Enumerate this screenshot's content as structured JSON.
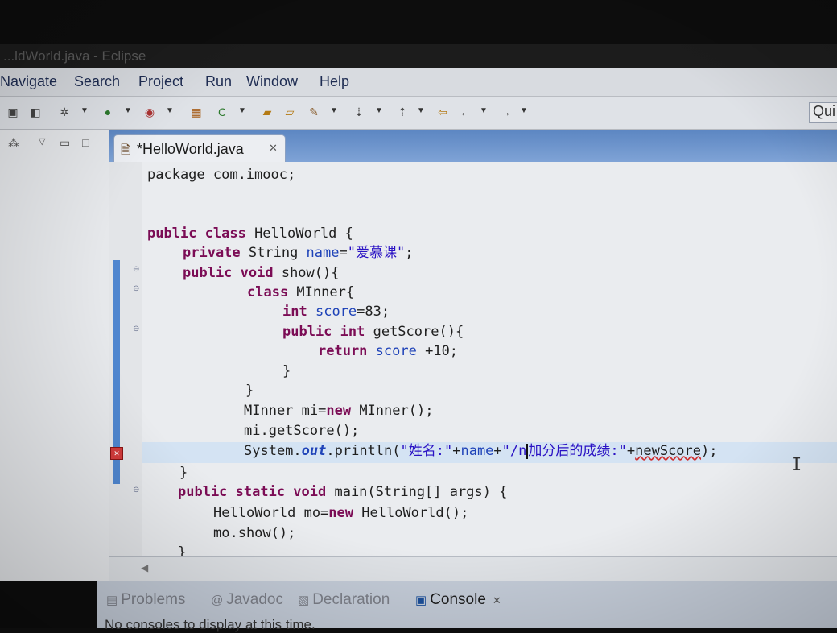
{
  "window": {
    "title": "...ldWorld.java - Eclipse"
  },
  "menu": [
    "Navigate",
    "Search",
    "Project",
    "Run",
    "Window",
    "Help"
  ],
  "toolbar": {
    "quick_access": "Qui",
    "icons": [
      "save-icon",
      "print-icon",
      "debug-icon",
      "run-icon",
      "external-tools-icon",
      "new-java-package-icon",
      "new-class-icon",
      "open-type-icon",
      "open-task-icon",
      "search-icon",
      "next-annotation-icon",
      "prev-annotation-icon",
      "last-edit-icon",
      "back-icon",
      "forward-icon"
    ]
  },
  "editor": {
    "tab_title": "*HelloWorld.java",
    "lines": {
      "l1": "package com.imooc;",
      "l3a": "public class",
      "l3b": " HelloWorld {",
      "l4a": "private",
      "l4b": " String ",
      "l4c": "name",
      "l4d": "=",
      "l4e": "\"爱慕课\"",
      "l4f": ";",
      "l5a": "public void",
      "l5b": " show(){",
      "l6a": "class",
      "l6b": " MInner{",
      "l7a": "int",
      "l7b": " ",
      "l7c": "score",
      "l7d": "=83;",
      "l8a": "public int",
      "l8b": " getScore(){",
      "l9a": "return",
      "l9b": " ",
      "l9c": "score",
      "l9d": " +10;",
      "l10": "}",
      "l11": "}",
      "l12a": "MInner mi=",
      "l12b": "new",
      "l12c": " MInner();",
      "l13": "mi.getScore();",
      "l14a": "System.",
      "l14b": "out",
      "l14c": ".println(",
      "l14d": "\"姓名:\"",
      "l14e": "+",
      "l14f": "name",
      "l14g": "+",
      "l14h": "\"/n",
      "l14i": "加分后的成绩:\"",
      "l14j": "+",
      "l14k": "newScore",
      "l14l": ");",
      "l15": "}",
      "l16a": "public static void",
      "l16b": " main(String[] args) {",
      "l17a": "HelloWorld mo=",
      "l17b": "new",
      "l17c": " HelloWorld();",
      "l18": "mo.show();",
      "l19": "}"
    }
  },
  "bottom_tabs": [
    {
      "label": "Problems",
      "icon": "problems-icon"
    },
    {
      "label": "Javadoc",
      "icon": "at-icon"
    },
    {
      "label": "Declaration",
      "icon": "declaration-icon"
    },
    {
      "label": "Console",
      "icon": "console-icon"
    }
  ],
  "console_message": "No consoles to display at this time.",
  "colors": {
    "keyword": "#7b0c55",
    "field": "#1f43b8",
    "string": "#2a12c4",
    "error": "#d03030",
    "tab_bar": "#5c86c2"
  }
}
